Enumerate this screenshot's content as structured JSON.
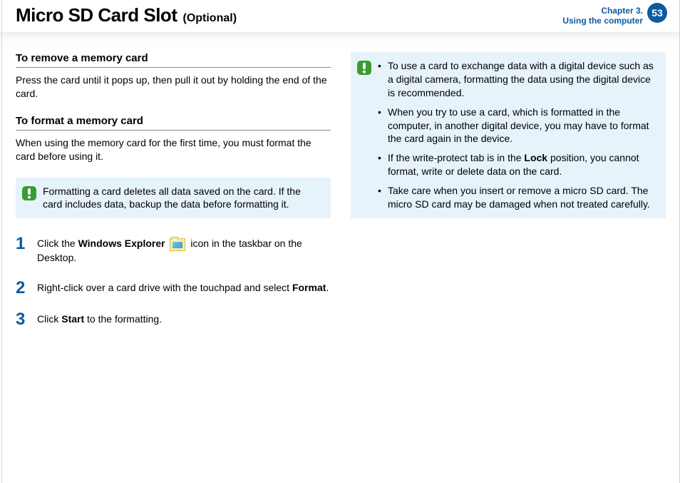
{
  "header": {
    "title": "Micro SD Card Slot",
    "subtitle": "(Optional)",
    "chapter_line1": "Chapter 3.",
    "chapter_line2": "Using the computer",
    "page_number": "53"
  },
  "left": {
    "section1_heading": "To remove a memory card",
    "section1_body": "Press the card until it pops up, then pull it out by holding the end of the card.",
    "section2_heading": "To format a memory card",
    "section2_body": "When using the memory card for the first time, you must format the card before using it.",
    "warn_box": "Formatting a card deletes all data saved on the card. If the card includes data, backup the data before formatting it.",
    "steps": {
      "s1_pre": "Click the ",
      "s1_bold": "Windows Explorer",
      "s1_post": " icon in the taskbar on the Desktop.",
      "s2_pre": "Right-click over a card drive with the touchpad and select ",
      "s2_bold": "Format",
      "s2_post": ".",
      "s3_pre": "Click ",
      "s3_bold": "Start",
      "s3_post": " to the formatting."
    }
  },
  "right": {
    "bullets": {
      "b1": "To use a card to exchange data with a digital device such as a digital camera, formatting the data using the digital device is recommended.",
      "b2": "When you try to use a card, which is formatted in the computer, in another digital device, you may have to format the card again in the device.",
      "b3_pre": "If the write-protect tab is in the ",
      "b3_bold": "Lock",
      "b3_post": " position, you cannot format, write or delete data on the card.",
      "b4": "Take care when you insert or remove a micro SD card. The micro SD card may be damaged when not treated carefully."
    }
  }
}
